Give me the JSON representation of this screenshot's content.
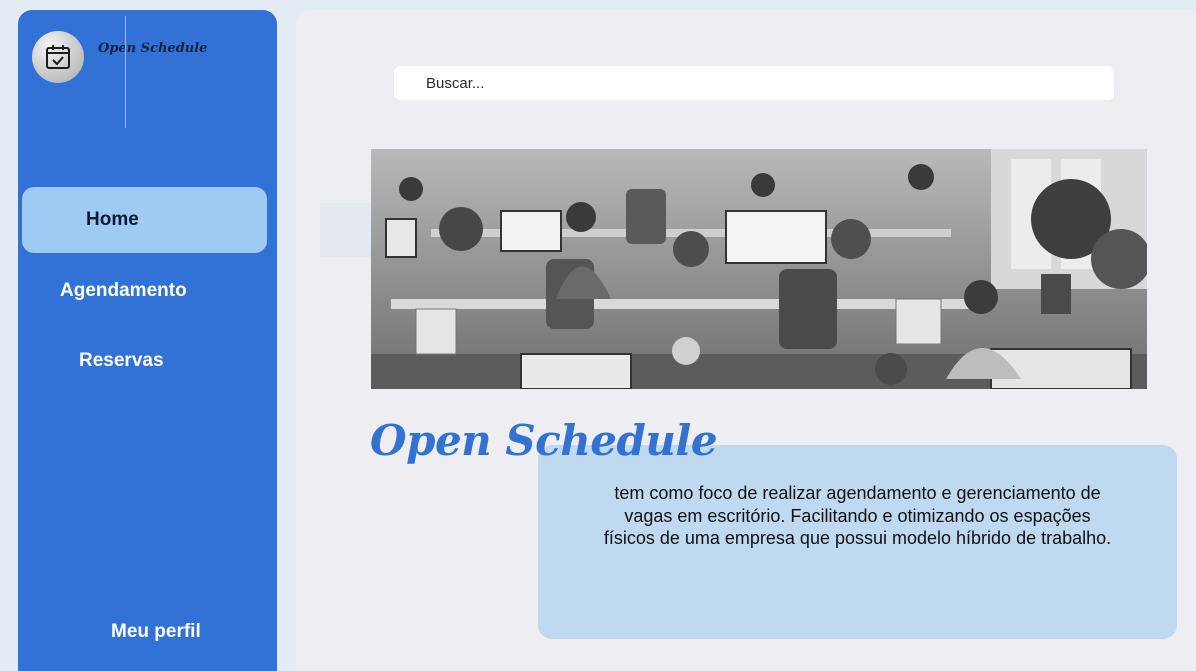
{
  "app": {
    "name": "Open Schedule"
  },
  "sidebar": {
    "logo_icon": "calendar-check-icon",
    "items": [
      {
        "label": "Home",
        "active": true
      },
      {
        "label": "Agendamento",
        "active": false
      },
      {
        "label": "Reservas",
        "active": false
      }
    ],
    "profile_label": "Meu perfil"
  },
  "search": {
    "placeholder": "Buscar..."
  },
  "hero": {
    "image": "office-coworking-photo",
    "title": "Open Schedule",
    "description": "tem como foco de realizar  agendamento e gerenciamento de vagas em escritório. Facilitando e otimizando os espações físicos de uma empresa que possui modelo híbrido de trabalho."
  },
  "colors": {
    "sidebar": "#3271d6",
    "active_item": "#9fcaf3",
    "title_accent": "#3371d3",
    "desc_box": "#bed9f0",
    "page_bg": "#e3ebf5"
  }
}
